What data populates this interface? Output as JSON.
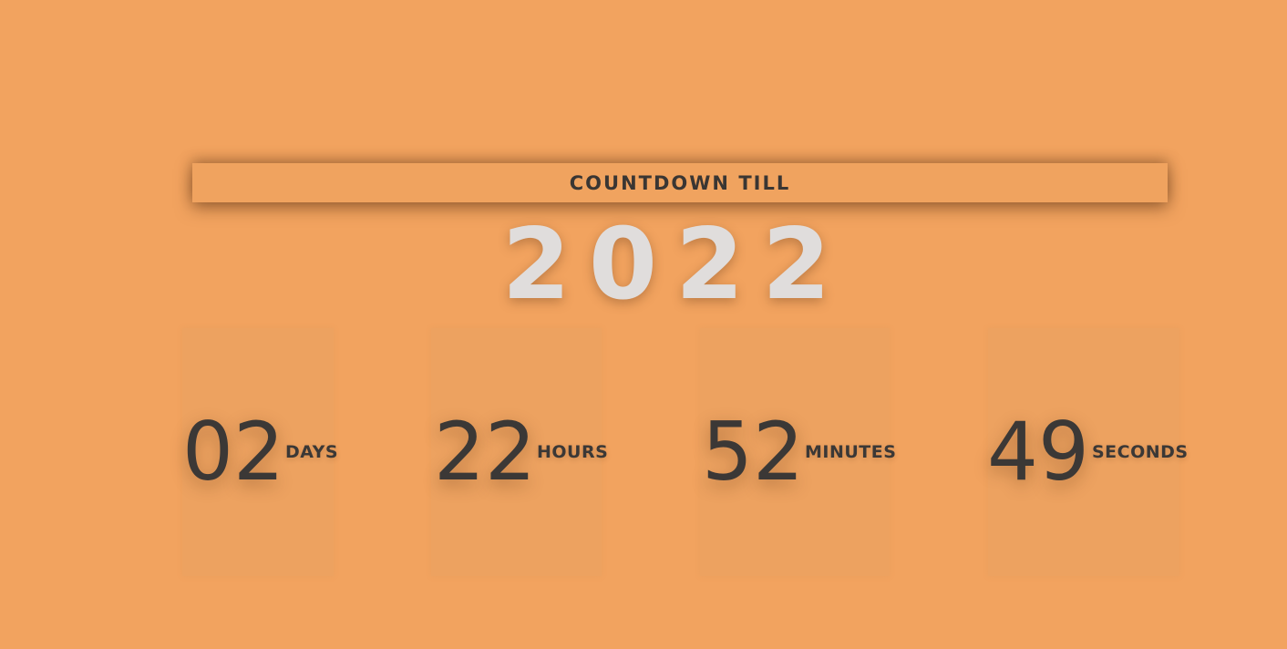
{
  "header": {
    "title": "COUNTDOWN TILL",
    "year": "2022"
  },
  "countdown": [
    {
      "value": "02",
      "unit": "DAYS"
    },
    {
      "value": "22",
      "unit": "HOURS"
    },
    {
      "value": "52",
      "unit": "MINUTES"
    },
    {
      "value": "49",
      "unit": "SECONDS"
    }
  ],
  "colors": {
    "background": "#f2a35f",
    "text_dark": "#3b3836",
    "year_text": "#e0dddc"
  }
}
